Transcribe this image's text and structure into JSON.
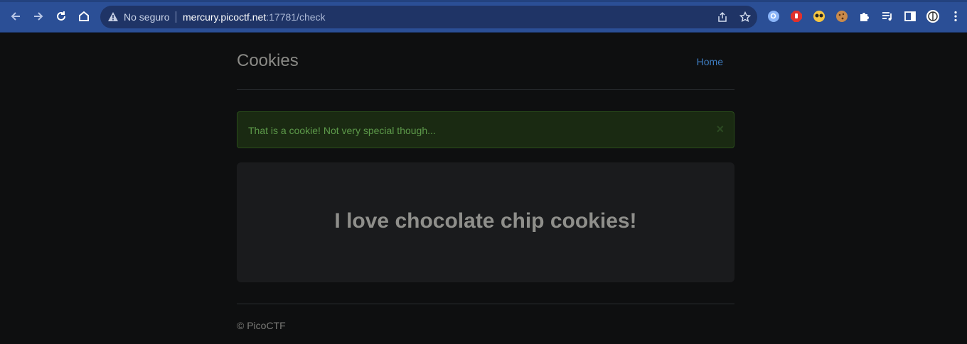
{
  "browser": {
    "security_status": "No seguro",
    "url_host": "mercury.picoctf.net",
    "url_rest": ":17781/check"
  },
  "site": {
    "brand": "Cookies",
    "nav_home": "Home",
    "alert_text": "That is a cookie! Not very special though...",
    "alert_close": "×",
    "jumbotron_title": "I love chocolate chip cookies!",
    "footer": "© PicoCTF"
  },
  "colors": {
    "toolbar": "#2b4f96",
    "page_bg": "#0e0f10",
    "link": "#3d7cc0",
    "alert_text": "#5d9a4a"
  }
}
